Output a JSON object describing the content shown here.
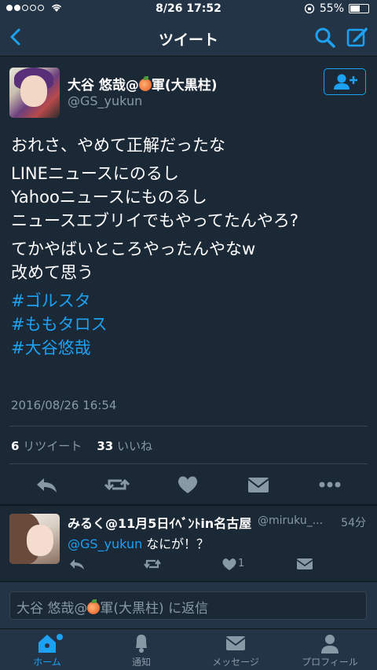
{
  "status_bar": {
    "time": "8/26 17:52",
    "battery": "55%",
    "battery_level": 0.55
  },
  "nav": {
    "title": "ツイート"
  },
  "tweet": {
    "author_name_pre": "大谷 悠哉@",
    "author_name_post": "軍(大黒柱)",
    "author_handle": "@GS_yukun",
    "lines": [
      "おれさ、やめて正解だったな",
      "LINEニュースにのるし",
      "Yahooニュースにものるし",
      "ニュースエブリイでもやってたんやろ?",
      "てかやばいところやったんやなw",
      "改めて思う"
    ],
    "hashtags": [
      "#ゴルスタ",
      "#ももタロス",
      "#大谷悠哉"
    ],
    "timestamp": "2016/08/26 16:54",
    "retweet_count": "6",
    "retweet_label": "リツイート",
    "like_count": "33",
    "like_label": "いいね"
  },
  "reply": {
    "author_name": "みるく@11月5日ｲﾍﾞﾝﾄin名古屋",
    "author_handle": "@miruku_...",
    "time": "54分",
    "mention": "@GS_yukun",
    "text": " なにが！？",
    "like_count": "1"
  },
  "reply_bar": {
    "placeholder_pre": "大谷 悠哉@",
    "placeholder_post": "軍(大黒柱) に返信"
  },
  "tabs": [
    {
      "label": "ホーム",
      "icon": "home-icon",
      "active": true
    },
    {
      "label": "通知",
      "icon": "bell-icon",
      "active": false
    },
    {
      "label": "メッセージ",
      "icon": "envelope-icon",
      "active": false
    },
    {
      "label": "プロフィール",
      "icon": "person-icon",
      "active": false
    }
  ],
  "colors": {
    "accent": "#1da1f2",
    "background": "#1b2836",
    "bar": "#243447",
    "muted": "#8899a6"
  }
}
